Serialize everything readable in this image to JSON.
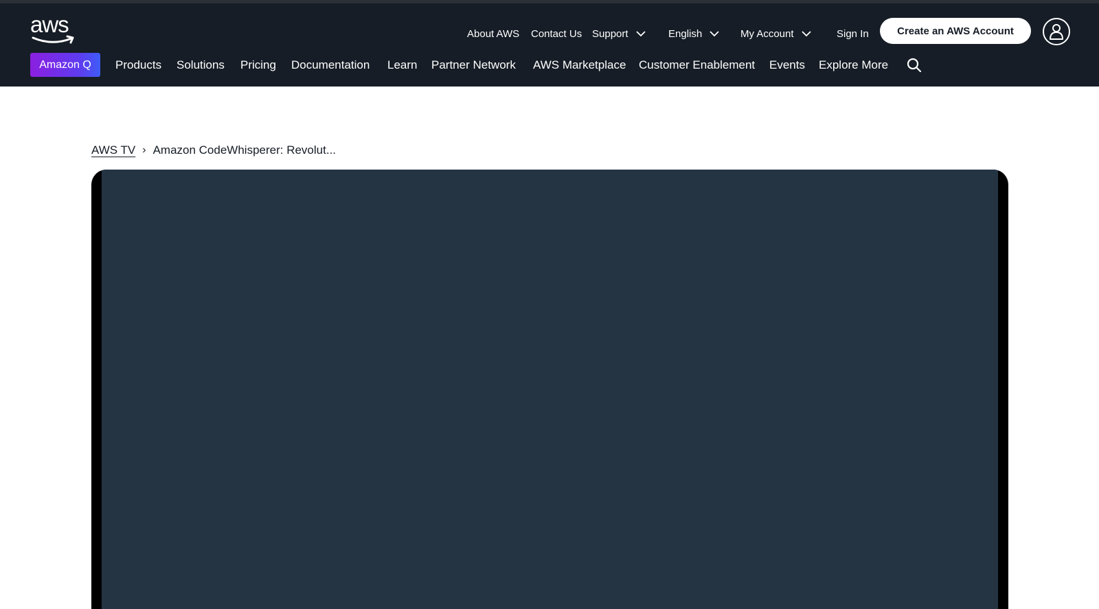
{
  "header": {
    "logo_text": "aws",
    "utility_links": {
      "about": "About AWS",
      "contact": "Contact Us",
      "support": "Support",
      "language": "English",
      "account": "My Account",
      "signin": "Sign In"
    },
    "create_account": "Create an AWS Account",
    "amazon_q": "Amazon Q",
    "nav": {
      "products": "Products",
      "solutions": "Solutions",
      "pricing": "Pricing",
      "documentation": "Documentation",
      "learn": "Learn",
      "partner": "Partner Network",
      "marketplace": "AWS Marketplace",
      "enablement": "Customer Enablement",
      "events": "Events",
      "explore": "Explore More"
    }
  },
  "breadcrumb": {
    "parent": "AWS TV",
    "separator": "›",
    "current": "Amazon CodeWhisperer: Revolut..."
  },
  "colors": {
    "header_bg": "#161d26",
    "amazon_q_gradient_start": "#8b1fe0",
    "amazon_q_gradient_end": "#3f5cf8",
    "video_bg": "#243443"
  }
}
